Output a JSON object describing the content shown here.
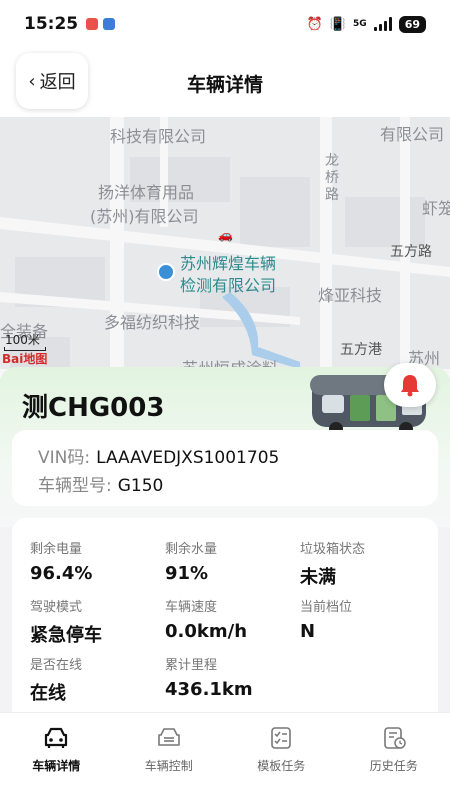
{
  "status_bar": {
    "time": "15:25",
    "network": "5G",
    "battery": "69"
  },
  "nav": {
    "back_label": "返回",
    "title": "车辆详情"
  },
  "map": {
    "labels": {
      "top_company": "科技有限公司",
      "top_right": "有限公司",
      "sports_1": "扬洋体育用品",
      "sports_2": "(苏州)有限公司",
      "road_vertical": "龙桥路",
      "shrimp": "虾笼",
      "wufang_road": "五方路",
      "poi_1": "苏州辉煌车辆",
      "poi_2": "检测有限公司",
      "fengya": "烽亚科技",
      "equipment": "全装备",
      "duofu": "多福纺织科技",
      "wufanggang": "五方港",
      "suzhou_right": "苏州",
      "bottom_partial": "苏州恒成涂料"
    },
    "scale": "100米",
    "logo": "Bai地图"
  },
  "vehicle": {
    "plate": "测CHG003",
    "vin_label": "VIN码:",
    "vin": "LAAAVEDJXS1001705",
    "model_label": "车辆型号:",
    "model": "G150"
  },
  "stats": [
    {
      "label": "剩余电量",
      "value": "96.4%"
    },
    {
      "label": "剩余水量",
      "value": "91%"
    },
    {
      "label": "垃圾箱状态",
      "value": "未满"
    },
    {
      "label": "驾驶模式",
      "value": "紧急停车"
    },
    {
      "label": "车辆速度",
      "value": "0.0km/h"
    },
    {
      "label": "当前档位",
      "value": "N"
    },
    {
      "label": "是否在线",
      "value": "在线"
    },
    {
      "label": "累计里程",
      "value": "436.1km"
    }
  ],
  "tabs": [
    {
      "label": "车辆详情",
      "icon": "car-icon",
      "active": true
    },
    {
      "label": "车辆控制",
      "icon": "car-control-icon",
      "active": false
    },
    {
      "label": "模板任务",
      "icon": "checklist-icon",
      "active": false
    },
    {
      "label": "历史任务",
      "icon": "history-icon",
      "active": false
    }
  ],
  "colors": {
    "accent_green": "#e2f4e0",
    "poi_teal": "#2d8a8e",
    "alarm_red": "#e53935"
  }
}
